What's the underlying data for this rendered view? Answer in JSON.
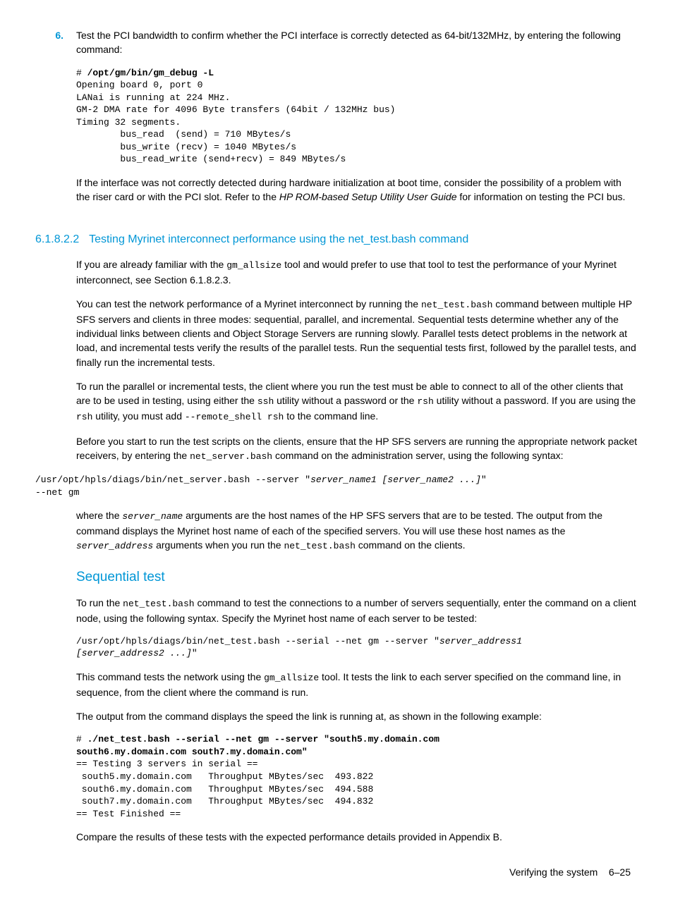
{
  "step6": {
    "num": "6.",
    "text_a": "Test the PCI bandwidth to confirm whether the PCI interface is correctly detected as 64-bit/132MHz, by entering the following command:",
    "code": "# /opt/gm/bin/gm_debug -L\nOpening board 0, port 0\nLANai is running at 224 MHz.\nGM-2 DMA rate for 4096 Byte transfers (64bit / 132MHz bus)\nTiming 32 segments.\n        bus_read  (send) = 710 MBytes/s\n        bus_write (recv) = 1040 MBytes/s\n        bus_read_write (send+recv) = 849 MBytes/s",
    "code_bold_line": "/opt/gm/bin/gm_debug -L",
    "text_b1": "If the interface was not correctly detected during hardware initialization at boot time, consider the possibility of a problem with the riser card or with the PCI slot. Refer to the ",
    "text_b_italic": "HP ROM-based Setup Utility User Guide",
    "text_b2": " for information on testing the PCI bus."
  },
  "section": {
    "num": "6.1.8.2.2",
    "title": "Testing Myrinet interconnect performance using the net_test.bash command"
  },
  "p1_a": "If you are already familiar with the ",
  "p1_code": "gm_allsize",
  "p1_b": " tool and would prefer to use that tool to test the performance of your Myrinet interconnect, see Section 6.1.8.2.3.",
  "p2_a": "You can test the network performance of a Myrinet interconnect by running the ",
  "p2_code": "net_test.bash",
  "p2_b": " command between multiple HP SFS servers and clients in three modes: sequential, parallel, and incremental. Sequential tests determine whether any of the individual links between clients and Object Storage Servers are running slowly. Parallel tests detect problems in the network at load, and incremental tests verify the results of the parallel tests. Run the sequential tests first, followed by the parallel tests, and finally run the incremental tests.",
  "p3_a": "To run the parallel or incremental tests, the client where you run the test must be able to connect to all of the other clients that are to be used in testing, using either the ",
  "p3_code1": "ssh",
  "p3_b": " utility without a password or the ",
  "p3_code2": "rsh",
  "p3_c": " utility without a password. If you are using the ",
  "p3_code3": "rsh",
  "p3_d": " utility, you must add ",
  "p3_code4": "--remote_shell rsh",
  "p3_e": " to the command line.",
  "p4_a": "Before you start to run the test scripts on the clients, ensure that the HP SFS servers are running the appropriate network packet receivers, by entering the ",
  "p4_code": "net_server.bash",
  "p4_b": " command on the administration server, using the following syntax:",
  "code2_a": "/usr/opt/hpls/diags/bin/net_server.bash --server \"",
  "code2_i": "server_name1 [server_name2 ...]",
  "code2_b": "\" \n--net gm",
  "p5_a": "where the ",
  "p5_code1": "server_name",
  "p5_b": " arguments are the host names of the HP SFS servers that are to be tested. The output from the command displays the Myrinet host name of each of the specified servers. You will use these host names as the ",
  "p5_code2": "server_address",
  "p5_c": " arguments when you run the ",
  "p5_code3": "net_test.bash",
  "p5_d": " command on the clients.",
  "subsection": "Sequential test",
  "p6_a": "To run the ",
  "p6_code": "net_test.bash",
  "p6_b": " command to test the connections to a number of servers sequentially, enter the command on a client node, using the following syntax. Specify the Myrinet host name of each server to be tested:",
  "code3_a": "/usr/opt/hpls/diags/bin/net_test.bash --serial --net gm --server \"",
  "code3_i": "server_address1 \n[server_address2 ...]",
  "code3_b": "\"",
  "p7_a": "This command tests the network using the ",
  "p7_code": "gm_allsize",
  "p7_b": " tool. It tests the link to each server specified on the command line, in sequence, from the client where the command is run.",
  "p8": "The output from the command displays the speed the link is running at, as shown in the following example:",
  "code4_bold": "./net_test.bash --serial --net gm --server \"south5.my.domain.com \nsouth6.my.domain.com south7.my.domain.com\"",
  "code4_rest": "== Testing 3 servers in serial ==\n south5.my.domain.com   Throughput MBytes/sec  493.822\n south6.my.domain.com   Throughput MBytes/sec  494.588\n south7.my.domain.com   Throughput MBytes/sec  494.832\n== Test Finished ==",
  "p9": "Compare the results of these tests with the expected performance details provided in Appendix B.",
  "footer_text": "Verifying the system",
  "footer_page": "6–25"
}
